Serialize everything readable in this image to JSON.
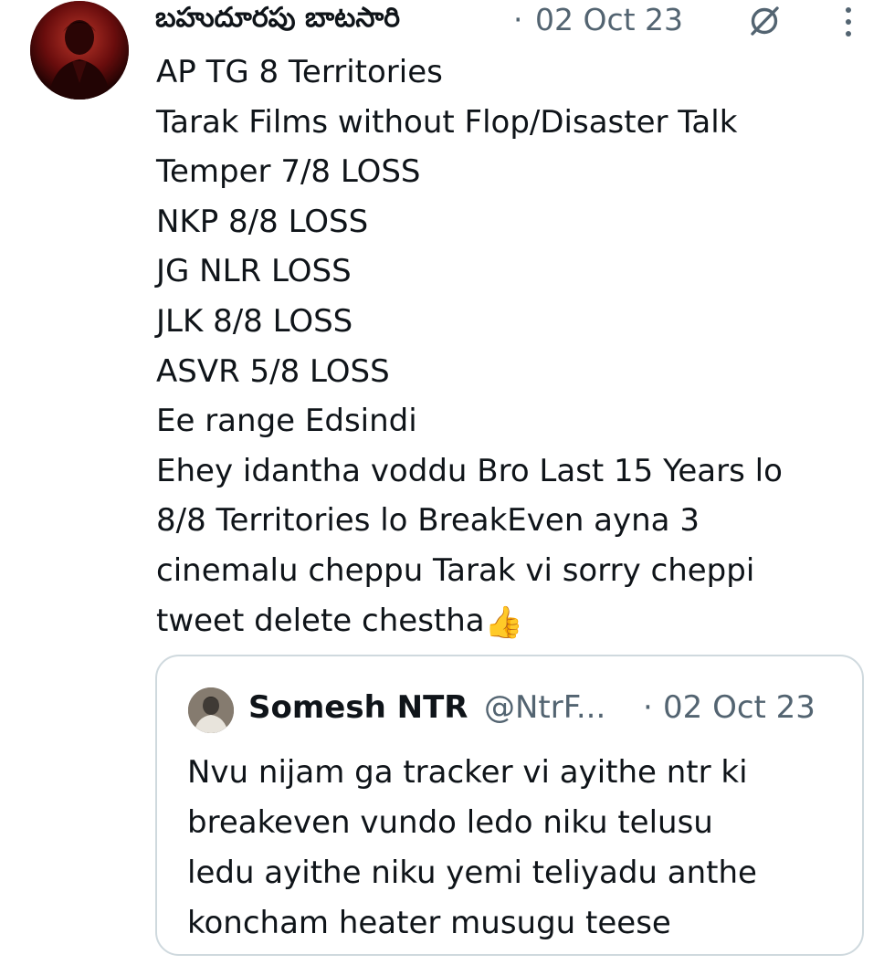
{
  "tweet": {
    "author": {
      "display_name": "బహుదూరపు బాటసారి",
      "avatar": "avatar"
    },
    "separator": "·",
    "date": "02 Oct 23",
    "icons": {
      "grok": "grok-icon",
      "more": "more-icon"
    },
    "text_lines": [
      "AP TG 8 Territories",
      "Tarak Films without Flop/Disaster Talk",
      "Temper 7/8 LOSS",
      "NKP 8/8 LOSS",
      "JG NLR LOSS",
      "JLK 8/8 LOSS",
      "ASVR 5/8 LOSS",
      "Ee range Edsindi",
      "Ehey idantha voddu Bro Last 15 Years lo",
      "8/8 Territories lo BreakEven ayna 3",
      "cinemalu cheppu Tarak vi sorry cheppi",
      "tweet delete chestha"
    ],
    "emoji": "👍"
  },
  "quoted_tweet": {
    "author": {
      "display_name": "Somesh NTR",
      "handle": "@NtrF...",
      "avatar": "avatar"
    },
    "separator": "·",
    "date": "02 Oct 23",
    "text_lines": [
      "Nvu nijam ga tracker vi ayithe ntr ki",
      "breakeven vundo ledo niku telusu",
      "ledu ayithe niku yemi teliyadu anthe",
      "koncham heater musugu teese"
    ]
  },
  "colors": {
    "text_primary": "#0f1419",
    "text_secondary": "#536471",
    "card_border": "#cfd9de"
  }
}
